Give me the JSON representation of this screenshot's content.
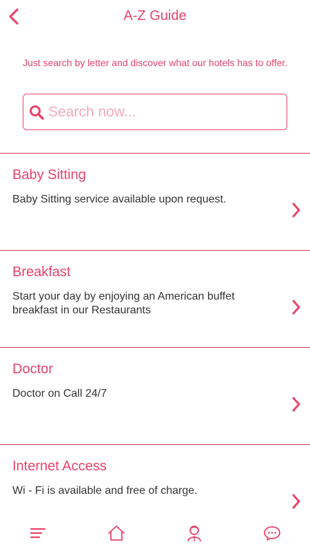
{
  "header": {
    "title": "A-Z Guide"
  },
  "intro_text": "Just search by letter and discover what our hotels has to offer.",
  "search": {
    "placeholder": "Search now..."
  },
  "items": [
    {
      "name": "Baby Sitting",
      "description": "Baby Sitting service available upon request."
    },
    {
      "name": "Breakfast",
      "description": "Start your day by enjoying an American buffet breakfast in our Restaurants"
    },
    {
      "name": "Doctor",
      "description": "Doctor on Call 24/7"
    },
    {
      "name": "Internet Access",
      "description": "Wi - Fi is available and free of charge."
    }
  ],
  "nav": [
    "menu-icon",
    "home-icon",
    "concierge-icon",
    "chat-icon"
  ],
  "colors": {
    "accent": "#e8436a",
    "divider": "#d62e56",
    "placeholder": "#f4a9bb"
  }
}
